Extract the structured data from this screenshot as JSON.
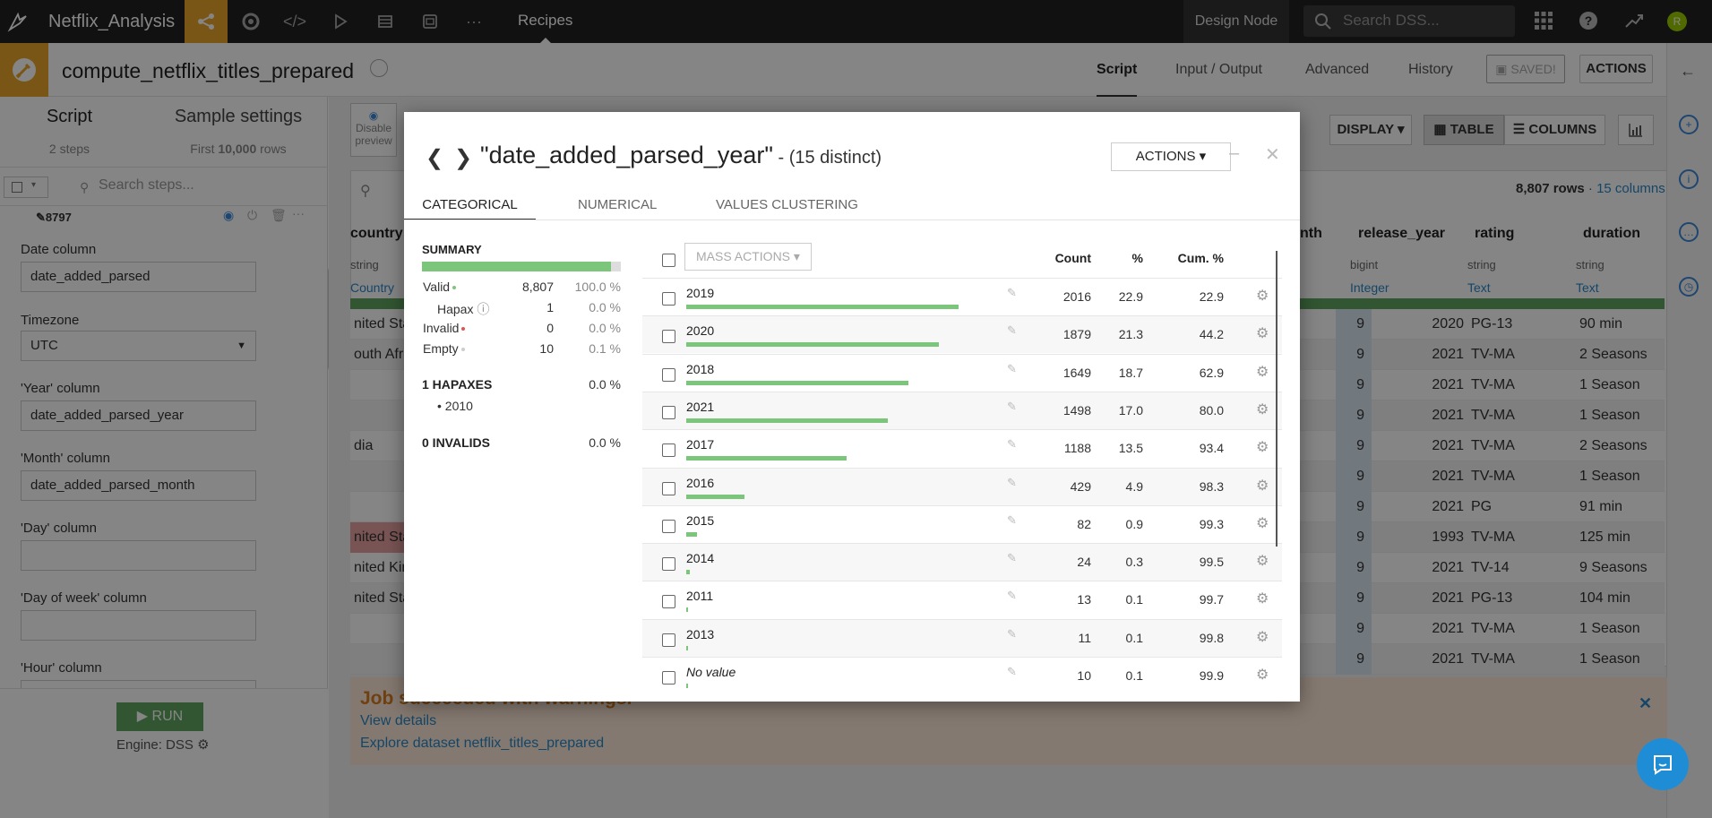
{
  "topbar": {
    "app_title": "Netflix_Analysis",
    "recipes": "Recipes",
    "design_node": "Design Node",
    "search_placeholder": "Search DSS...",
    "avatar_initial": "R",
    "icons": [
      "flow-icon",
      "jobs-icon",
      "code-icon",
      "play-icon",
      "database-icon",
      "dashboard-icon",
      "more-icon"
    ]
  },
  "header": {
    "recipe_name": "compute_netflix_titles_prepared",
    "tabs": [
      "Script",
      "Input / Output",
      "Advanced",
      "History"
    ],
    "saved": "SAVED!",
    "actions": "ACTIONS"
  },
  "left_panel": {
    "tab_script": "Script",
    "tab_sample": "Sample settings",
    "steps": "2 steps",
    "rows_prefix": "First ",
    "rows_count": "10,000",
    "rows_suffix": " rows",
    "search_placeholder": "Search steps...",
    "step_id": "8797",
    "fields": [
      {
        "label": "Date column",
        "value": "date_added_parsed"
      },
      {
        "label": "Timezone",
        "value": "UTC"
      },
      {
        "label": "'Year' column",
        "value": "date_added_parsed_year"
      },
      {
        "label": "'Month' column",
        "value": "date_added_parsed_month"
      },
      {
        "label": "'Day' column",
        "value": ""
      },
      {
        "label": "'Day of week' column",
        "value": ""
      },
      {
        "label": "'Hour' column",
        "value": ""
      }
    ],
    "run": "RUN",
    "engine": "Engine: DSS"
  },
  "data_panel": {
    "disable_preview": "Disable preview",
    "display": "DISPLAY",
    "table": "TABLE",
    "columns": "COLUMNS",
    "rows": "8,807 rows",
    "cols": "15 columns",
    "col_headers": [
      {
        "name": "country",
        "type": "string",
        "meaning": "Country"
      },
      {
        "name": "nth",
        "type": "",
        "meaning": ""
      },
      {
        "name": "release_year",
        "type": "bigint",
        "meaning": "Integer"
      },
      {
        "name": "rating",
        "type": "string",
        "meaning": "Text"
      },
      {
        "name": "duration",
        "type": "string",
        "meaning": "Text"
      }
    ],
    "rows_data": [
      [
        "nited Stat",
        "9",
        "2020",
        "PG-13",
        "90 min"
      ],
      [
        "outh Afric",
        "9",
        "2021",
        "TV-MA",
        "2 Seasons"
      ],
      [
        "",
        "9",
        "2021",
        "TV-MA",
        "1 Season"
      ],
      [
        "",
        "9",
        "2021",
        "TV-MA",
        "1 Season"
      ],
      [
        "dia",
        "9",
        "2021",
        "TV-MA",
        "2 Seasons"
      ],
      [
        "",
        "9",
        "2021",
        "TV-MA",
        "1 Season"
      ],
      [
        "",
        "9",
        "2021",
        "PG",
        "91 min"
      ],
      [
        "nited Stat",
        "9",
        "1993",
        "TV-MA",
        "125 min"
      ],
      [
        "nited King",
        "9",
        "2021",
        "TV-14",
        "9 Seasons"
      ],
      [
        "nited Stat",
        "9",
        "2021",
        "PG-13",
        "104 min"
      ],
      [
        "",
        "9",
        "2021",
        "TV-MA",
        "1 Season"
      ],
      [
        "",
        "9",
        "2021",
        "TV-MA",
        "1 Season"
      ]
    ],
    "warning_title": "Job succeeded with warnings.",
    "view_details": "View details",
    "explore": "Explore dataset netflix_titles_prepared"
  },
  "modal": {
    "column": "\"date_added_parsed_year\"",
    "distinct": " - (15 distinct)",
    "actions": "ACTIONS",
    "tabs": [
      "CATEGORICAL",
      "NUMERICAL",
      "VALUES CLUSTERING"
    ],
    "summary_title": "SUMMARY",
    "valid_fraction": 0.95,
    "summary": [
      {
        "label": "Valid",
        "value": "8,807",
        "pct": "100.0 %",
        "dot": "#7cc67c"
      },
      {
        "label": "Hapax",
        "value": "1",
        "pct": "0.0 %",
        "dot": ""
      },
      {
        "label": "Invalid",
        "value": "0",
        "pct": "0.0 %",
        "dot": "#e0534f"
      },
      {
        "label": "Empty",
        "value": "10",
        "pct": "0.1 %",
        "dot": "#ccc"
      }
    ],
    "hapax_title": "1 HAPAXES",
    "hapax_pct": "0.0 %",
    "hapax_values": [
      "2010"
    ],
    "invalids_title": "0 INVALIDS",
    "invalids_pct": "0.0 %",
    "mass_actions": "MASS ACTIONS",
    "headers": {
      "count": "Count",
      "pct": "%",
      "cum": "Cum. %"
    },
    "values": [
      {
        "label": "2019",
        "count": "2016",
        "pct": "22.9",
        "cum": "22.9",
        "share": 0.229
      },
      {
        "label": "2020",
        "count": "1879",
        "pct": "21.3",
        "cum": "44.2",
        "share": 0.213
      },
      {
        "label": "2018",
        "count": "1649",
        "pct": "18.7",
        "cum": "62.9",
        "share": 0.187
      },
      {
        "label": "2021",
        "count": "1498",
        "pct": "17.0",
        "cum": "80.0",
        "share": 0.17
      },
      {
        "label": "2017",
        "count": "1188",
        "pct": "13.5",
        "cum": "93.4",
        "share": 0.135
      },
      {
        "label": "2016",
        "count": "429",
        "pct": "4.9",
        "cum": "98.3",
        "share": 0.049
      },
      {
        "label": "2015",
        "count": "82",
        "pct": "0.9",
        "cum": "99.3",
        "share": 0.009
      },
      {
        "label": "2014",
        "count": "24",
        "pct": "0.3",
        "cum": "99.5",
        "share": 0.003
      },
      {
        "label": "2011",
        "count": "13",
        "pct": "0.1",
        "cum": "99.7",
        "share": 0.001
      },
      {
        "label": "2013",
        "count": "11",
        "pct": "0.1",
        "cum": "99.8",
        "share": 0.001
      },
      {
        "label": "No value",
        "count": "10",
        "pct": "0.1",
        "cum": "99.9",
        "share": 0.001
      }
    ]
  },
  "colors": {
    "accent": "#e8a52b",
    "bar": "#7cc67c",
    "link": "#2a87c8",
    "warn": "#d57b22"
  }
}
